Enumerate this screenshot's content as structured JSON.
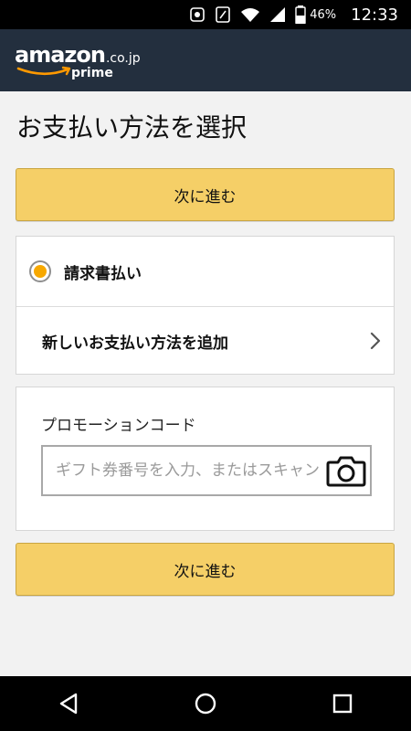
{
  "status_bar": {
    "battery_percent": "46%",
    "time": "12:33",
    "icons": [
      "notification-icon",
      "nfc-icon",
      "wifi-icon",
      "signal-icon",
      "battery-icon"
    ]
  },
  "header": {
    "logo_main": "amazon",
    "logo_tld": ".co.jp",
    "logo_sub": "prime"
  },
  "page": {
    "title": "お支払い方法を選択"
  },
  "buttons": {
    "continue_top": "次に進む",
    "continue_bottom": "次に進む"
  },
  "payment_methods": {
    "selected_option": "請求書払い",
    "add_new": "新しいお支払い方法を追加"
  },
  "promo": {
    "label": "プロモーションコード",
    "placeholder": "ギフト券番号を入力、またはスキャン",
    "value": ""
  },
  "nav": {
    "icons": [
      "back-icon",
      "home-icon",
      "recents-icon"
    ]
  },
  "colors": {
    "header_bg": "#232f3e",
    "button_bg": "#f5cf67",
    "radio_accent": "#f7a800",
    "page_bg": "#f2f2f2"
  }
}
